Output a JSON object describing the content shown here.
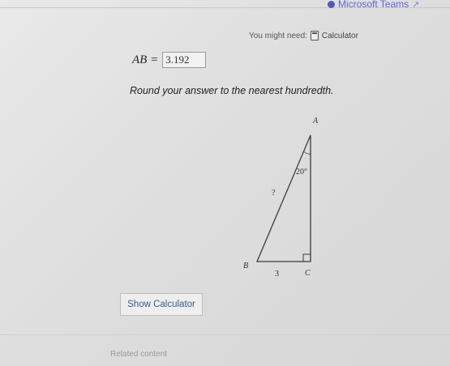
{
  "header": {
    "teams_link": "Microsoft Teams",
    "might_need_label": "You might need:",
    "calculator_link": "Calculator"
  },
  "question": {
    "answer_label": "AB =",
    "answer_value": "3.192",
    "instruction": "Round your answer to the nearest hundredth."
  },
  "diagram": {
    "vertex_a": "A",
    "vertex_b": "B",
    "vertex_c": "C",
    "angle_a": "20°",
    "hypotenuse": "?",
    "side_bc": "3"
  },
  "buttons": {
    "show_calculator": "Show Calculator"
  },
  "footer": {
    "related": "Related content"
  },
  "colors": {
    "link": "#3a5a8c",
    "teams": "#5b6bd5"
  }
}
